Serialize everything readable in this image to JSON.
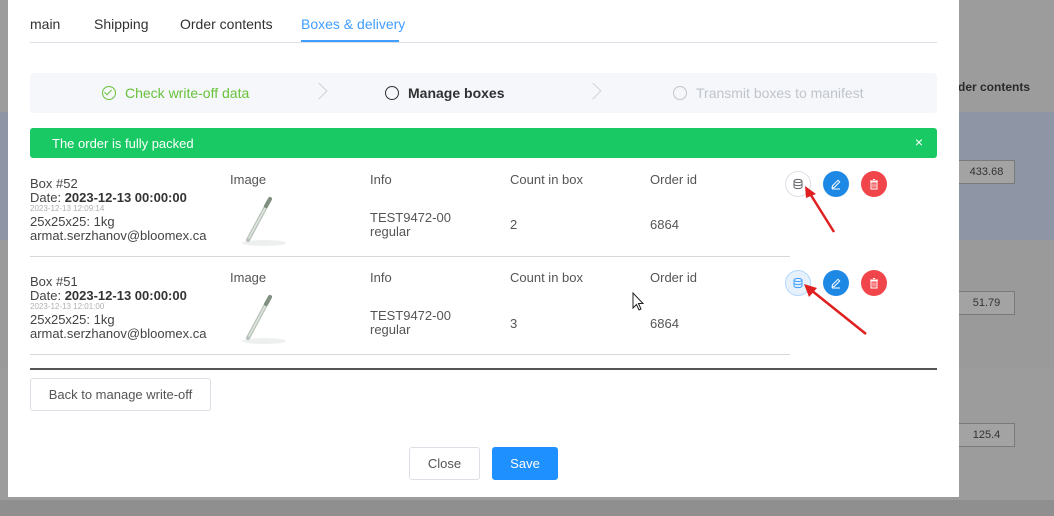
{
  "background": {
    "header_fragment": "der contents",
    "cells": [
      "433.68",
      "51.79",
      "125.4"
    ]
  },
  "tabs": [
    {
      "label": "main"
    },
    {
      "label": "Shipping"
    },
    {
      "label": "Order contents"
    },
    {
      "label": "Boxes & delivery",
      "active": true
    }
  ],
  "steps": [
    {
      "label": "Check write-off data",
      "status": "done"
    },
    {
      "label": "Manage boxes",
      "status": "current"
    },
    {
      "label": "Transmit boxes to manifest",
      "status": "wait"
    }
  ],
  "alert": {
    "text": "The order is fully packed",
    "close": "×"
  },
  "columns": {
    "image": "Image",
    "info": "Info",
    "count": "Count in box",
    "order": "Order id"
  },
  "boxes": [
    {
      "title": "Box #52",
      "date_label": "Date: ",
      "date": "2023-12-13 00:00:00",
      "timestamp": "2023-12-13 12:09:14",
      "dims": "25x25x25: 1kg",
      "email": "armat.serzhanov@bloomex.ca",
      "info_line1": "TEST9472-00",
      "info_line2": "regular",
      "count": "2",
      "order_id": "6864"
    },
    {
      "title": "Box #51",
      "date_label": "Date: ",
      "date": "2023-12-13 00:00:00",
      "timestamp": "2023-12-13 12:01:00",
      "dims": "25x25x25: 1kg",
      "email": "armat.serzhanov@bloomex.ca",
      "info_line1": "TEST9472-00",
      "info_line2": "regular",
      "count": "3",
      "order_id": "6864"
    }
  ],
  "buttons": {
    "back": "Back to manage write-off",
    "close": "Close",
    "save": "Save"
  },
  "colors": {
    "primary": "#409eff",
    "success": "#19c964",
    "danger": "#f0464b",
    "annotation": "#e02020"
  }
}
